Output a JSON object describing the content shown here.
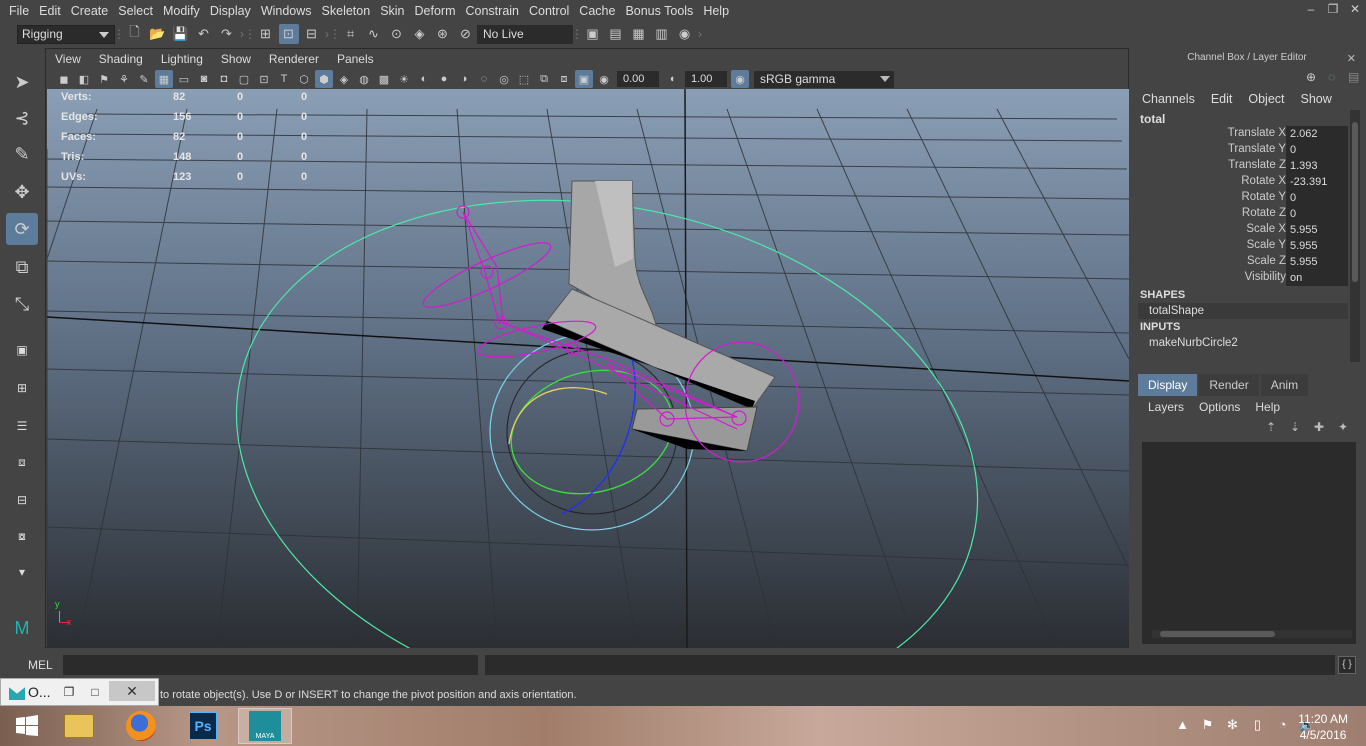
{
  "menubar": {
    "items": [
      "File",
      "Edit",
      "Create",
      "Select",
      "Modify",
      "Display",
      "Windows",
      "Skeleton",
      "Skin",
      "Deform",
      "Constrain",
      "Control",
      "Cache",
      "Bonus Tools",
      "Help"
    ],
    "window_controls": [
      "–",
      "❐",
      "✕"
    ]
  },
  "status_line": {
    "mode": "Rigging",
    "live_surface": "No Live Surface"
  },
  "viewport": {
    "menu": [
      "View",
      "Shading",
      "Lighting",
      "Show",
      "Renderer",
      "Panels"
    ],
    "exposure": "0.00",
    "gamma": "1.00",
    "color_space": "sRGB gamma",
    "hud": [
      {
        "label": "Verts:",
        "v1": "82",
        "v2": "0",
        "v3": "0"
      },
      {
        "label": "Edges:",
        "v1": "156",
        "v2": "0",
        "v3": "0"
      },
      {
        "label": "Faces:",
        "v1": "82",
        "v2": "0",
        "v3": "0"
      },
      {
        "label": "Tris:",
        "v1": "148",
        "v2": "0",
        "v3": "0"
      },
      {
        "label": "UVs:",
        "v1": "123",
        "v2": "0",
        "v3": "0"
      }
    ],
    "axis_x": "x",
    "axis_y": "y"
  },
  "channel_box": {
    "header": "Channel Box / Layer Editor",
    "menu": [
      "Channels",
      "Edit",
      "Object",
      "Show"
    ],
    "object": "total",
    "attributes": [
      {
        "name": "Translate X",
        "value": "2.062"
      },
      {
        "name": "Translate Y",
        "value": "0"
      },
      {
        "name": "Translate Z",
        "value": "1.393"
      },
      {
        "name": "Rotate X",
        "value": "-23.391"
      },
      {
        "name": "Rotate Y",
        "value": "0"
      },
      {
        "name": "Rotate Z",
        "value": "0"
      },
      {
        "name": "Scale X",
        "value": "5.955"
      },
      {
        "name": "Scale Y",
        "value": "5.955"
      },
      {
        "name": "Scale Z",
        "value": "5.955"
      },
      {
        "name": "Visibility",
        "value": "on"
      }
    ],
    "shapes_label": "SHAPES",
    "shape": "totalShape",
    "inputs_label": "INPUTS",
    "input": "makeNurbCircle2"
  },
  "layer_editor": {
    "tabs": [
      "Display",
      "Render",
      "Anim"
    ],
    "menu": [
      "Layers",
      "Options",
      "Help"
    ]
  },
  "command_line": {
    "label": "MEL"
  },
  "help_line": {
    "text": "to rotate object(s). Use D or INSERT to change the pivot position and axis orientation."
  },
  "minimized_window": {
    "title": "O..."
  },
  "taskbar": {
    "time": "11:20 AM",
    "date": "4/5/2016",
    "apps": [
      "File Explorer",
      "Firefox",
      "Photoshop",
      "Maya"
    ],
    "ps_label": "Ps",
    "maya_label": "MAYA"
  }
}
